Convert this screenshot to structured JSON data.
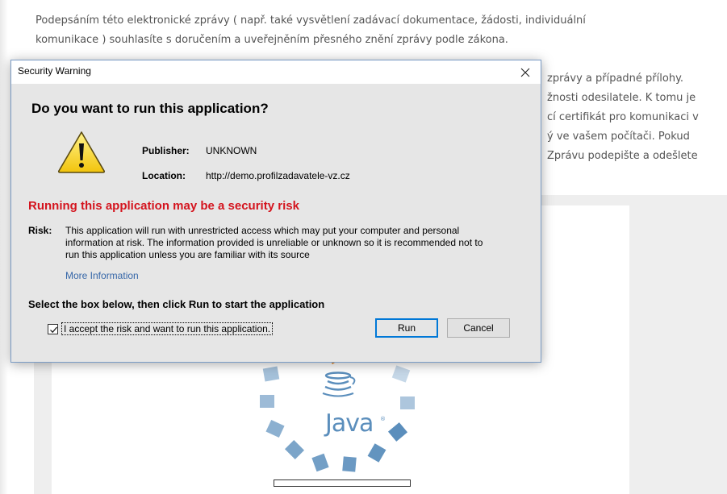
{
  "background_page": {
    "paragraph_1": [
      "Podepsáním této elektronické zprávy ( např. také vysvětlení zadávací dokumentace, žádosti, individuální",
      "komunikace ) souhlasíte s doručením a uveřejněním přesného znění zprávy podle zákona."
    ],
    "paragraph_2": [
      "zprávy a případné přílohy.",
      "žnosti odesilatele. K tomu je",
      "cí certifikát pro komunikaci v",
      "ý ve vašem počítači. Pokud",
      "Zprávu podepište a odešlete"
    ],
    "java_logo_text": "Java",
    "java_trademark": "®",
    "loading_progress": 0
  },
  "dialog": {
    "title": "Security Warning",
    "heading": "Do you want to run this application?",
    "publisher_label": "Publisher:",
    "publisher_value": "UNKNOWN",
    "location_label": "Location:",
    "location_value": "http://demo.profilzadavatele-vz.cz",
    "risk_warning": "Running this application may be a security risk",
    "risk_label": "Risk:",
    "risk_text": [
      "This application will run with unrestricted access which may put your computer and personal",
      "information at risk. The information provided is unreliable or unknown so it is recommended not to",
      "run this application unless you are familiar with its source"
    ],
    "more_info_link": "More Information",
    "instruction": "Select the box below, then click Run to start the application",
    "accept_label": "I accept the risk and want to run this application.",
    "accept_checked": true,
    "run_button": "Run",
    "cancel_button": "Cancel"
  },
  "icons": {
    "close": "close-x-icon",
    "warning": "warning-triangle-icon",
    "checkbox": "checkmark-icon",
    "java_cup": "java-coffee-cup-icon"
  },
  "colors": {
    "risk_red": "#d4141e",
    "link_blue": "#3566a8",
    "java_blue": "#5b8ebc",
    "java_orange": "#e8861e",
    "focus_blue": "#0078d7"
  }
}
